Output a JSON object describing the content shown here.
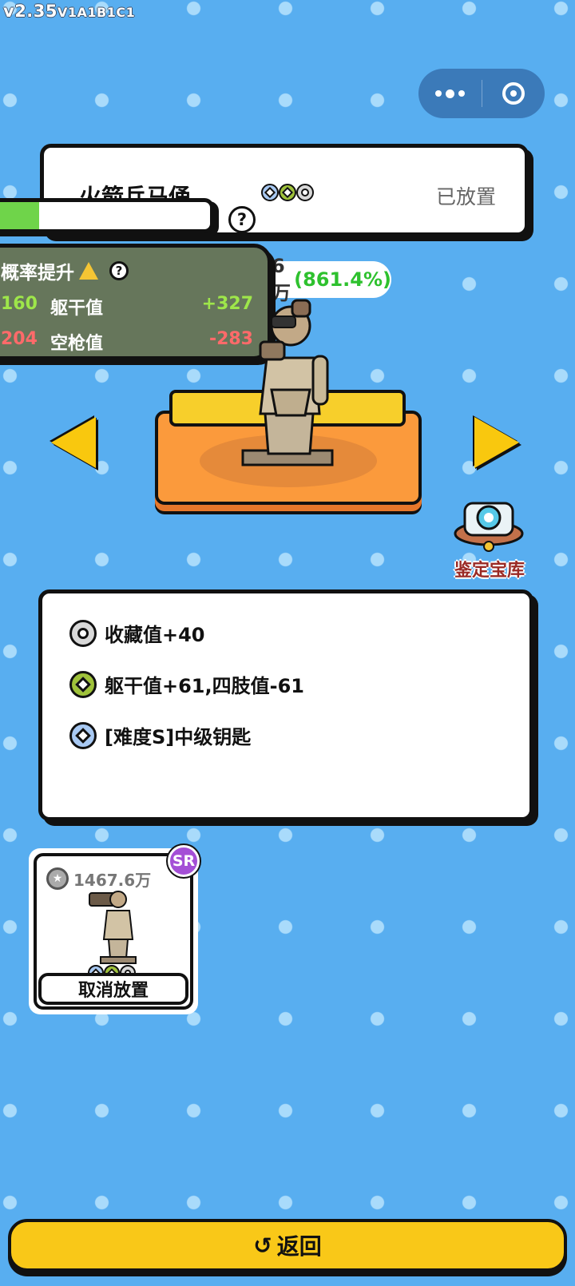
{
  "version": {
    "main": "v2.35",
    "sub": "V1A1B1C1"
  },
  "header": {
    "title": "火箭兵马俑",
    "status": "已放置",
    "gem_icons": [
      "blue-diamond",
      "green-diamond",
      "gray-circle"
    ]
  },
  "progress": {
    "fill_percent": 0.2
  },
  "value_pill": {
    "value": "6万",
    "percent": "(861.4%)"
  },
  "stats": {
    "header": "概率提升",
    "rows": [
      {
        "left": "160",
        "name": "躯干值",
        "delta": "+327"
      },
      {
        "left": "204",
        "name": "空枪值",
        "delta": "-283"
      }
    ]
  },
  "vault": {
    "label": "鉴定宝库"
  },
  "description": {
    "lines": [
      {
        "icon": "gray-circle",
        "text": "收藏值+40"
      },
      {
        "icon": "green-diamond",
        "text": "躯干值+61,四肢值-61"
      },
      {
        "icon": "blue-diamond",
        "text": "[难度S]中级钥匙"
      }
    ]
  },
  "item_card": {
    "price": "1467.6万",
    "rarity": "SR",
    "action": "取消放置"
  },
  "footer": {
    "back_label": "返回"
  },
  "colors": {
    "background": "#58aef0",
    "accent_yellow": "#f9c818",
    "positive": "#2ec12e",
    "negative": "#ff6a6a"
  }
}
